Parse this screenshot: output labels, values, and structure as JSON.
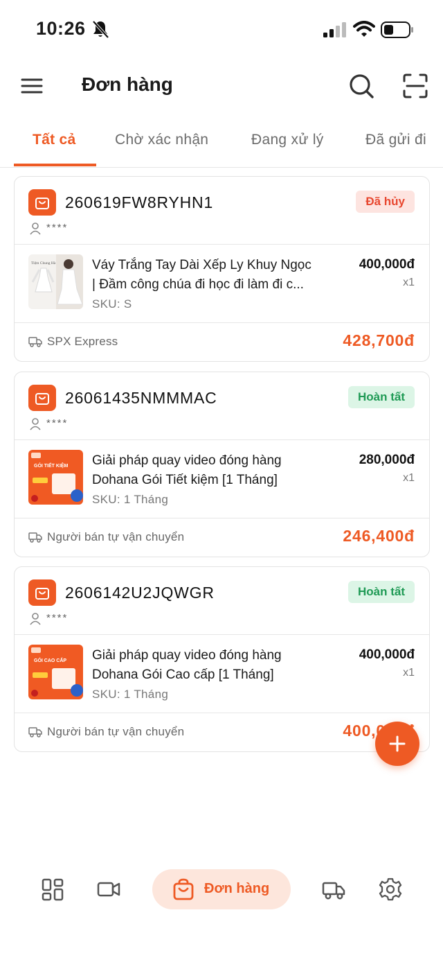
{
  "status_bar": {
    "time": "10:26"
  },
  "header": {
    "title": "Đơn hàng"
  },
  "tabs": [
    {
      "label": "Tất cả",
      "active": true
    },
    {
      "label": "Chờ xác nhận",
      "active": false
    },
    {
      "label": "Đang xử lý",
      "active": false
    },
    {
      "label": "Đã gửi đi",
      "active": false
    }
  ],
  "orders": [
    {
      "code": "260619FW8RYHN1",
      "customer": "****",
      "status": "Đã hủy",
      "product_line1": "Váy Trắng Tay Dài Xếp Ly Khuy Ngọc",
      "product_line2": "| Đầm công chúa đi học đi làm đi c...",
      "sku": "SKU: S",
      "price": "400,000đ",
      "qty": "x1",
      "shipping": "SPX Express",
      "total": "428,700đ",
      "thumb_caption": "Tiệm Chung Hà"
    },
    {
      "code": "26061435NMMMAC",
      "customer": "****",
      "status": "Hoàn tất",
      "product_line1": "Giải pháp quay video đóng hàng",
      "product_line2": "Dohana Gói Tiết kiệm [1 Tháng]",
      "sku": "SKU: 1 Tháng",
      "price": "280,000đ",
      "qty": "x1",
      "shipping": "Người bán tự vận chuyển",
      "total": "246,400đ",
      "thumb_caption": "GÓI TIẾT KIỆM"
    },
    {
      "code": "2606142U2JQWGR",
      "customer": "****",
      "status": "Hoàn tất",
      "product_line1": "Giải pháp quay video đóng hàng",
      "product_line2": "Dohana Gói Cao cấp [1 Tháng]",
      "sku": "SKU: 1 Tháng",
      "price": "400,000đ",
      "qty": "x1",
      "shipping": "Người bán tự vận chuyển",
      "total": "400,000đ",
      "thumb_caption": "GÓI CAO CẤP"
    }
  ],
  "bottom_nav": {
    "items": [
      "dashboard-icon",
      "video-icon",
      "orders-icon",
      "truck-icon",
      "settings-icon"
    ],
    "active_label": "Đơn hàng"
  },
  "colors": {
    "accent": "#ee5a24",
    "success": "#1f9a55",
    "danger": "#e8472f"
  }
}
